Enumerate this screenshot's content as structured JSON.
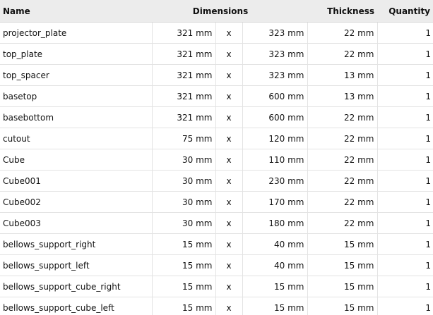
{
  "headers": {
    "name": "Name",
    "dimensions": "Dimensions",
    "thickness": "Thickness",
    "quantity": "Quantity"
  },
  "rows": [
    {
      "name": "projector_plate",
      "width": "321 mm",
      "sep": "x",
      "depth": "323 mm",
      "thickness": "22 mm",
      "quantity": "1"
    },
    {
      "name": "top_plate",
      "width": "321 mm",
      "sep": "x",
      "depth": "323 mm",
      "thickness": "22 mm",
      "quantity": "1"
    },
    {
      "name": "top_spacer",
      "width": "321 mm",
      "sep": "x",
      "depth": "323 mm",
      "thickness": "13 mm",
      "quantity": "1"
    },
    {
      "name": "basetop",
      "width": "321 mm",
      "sep": "x",
      "depth": "600 mm",
      "thickness": "13 mm",
      "quantity": "1"
    },
    {
      "name": "basebottom",
      "width": "321 mm",
      "sep": "x",
      "depth": "600 mm",
      "thickness": "22 mm",
      "quantity": "1"
    },
    {
      "name": "cutout",
      "width": "75 mm",
      "sep": "x",
      "depth": "120 mm",
      "thickness": "22 mm",
      "quantity": "1"
    },
    {
      "name": "Cube",
      "width": "30 mm",
      "sep": "x",
      "depth": "110 mm",
      "thickness": "22 mm",
      "quantity": "1"
    },
    {
      "name": "Cube001",
      "width": "30 mm",
      "sep": "x",
      "depth": "230 mm",
      "thickness": "22 mm",
      "quantity": "1"
    },
    {
      "name": "Cube002",
      "width": "30 mm",
      "sep": "x",
      "depth": "170 mm",
      "thickness": "22 mm",
      "quantity": "1"
    },
    {
      "name": "Cube003",
      "width": "30 mm",
      "sep": "x",
      "depth": "180 mm",
      "thickness": "22 mm",
      "quantity": "1"
    },
    {
      "name": "bellows_support_right",
      "width": "15 mm",
      "sep": "x",
      "depth": "40 mm",
      "thickness": "15 mm",
      "quantity": "1"
    },
    {
      "name": "bellows_support_left",
      "width": "15 mm",
      "sep": "x",
      "depth": "40 mm",
      "thickness": "15 mm",
      "quantity": "1"
    },
    {
      "name": "bellows_support_cube_right",
      "width": "15 mm",
      "sep": "x",
      "depth": "15 mm",
      "thickness": "15 mm",
      "quantity": "1"
    },
    {
      "name": "bellows_support_cube_left",
      "width": "15 mm",
      "sep": "x",
      "depth": "15 mm",
      "thickness": "15 mm",
      "quantity": "1"
    }
  ]
}
